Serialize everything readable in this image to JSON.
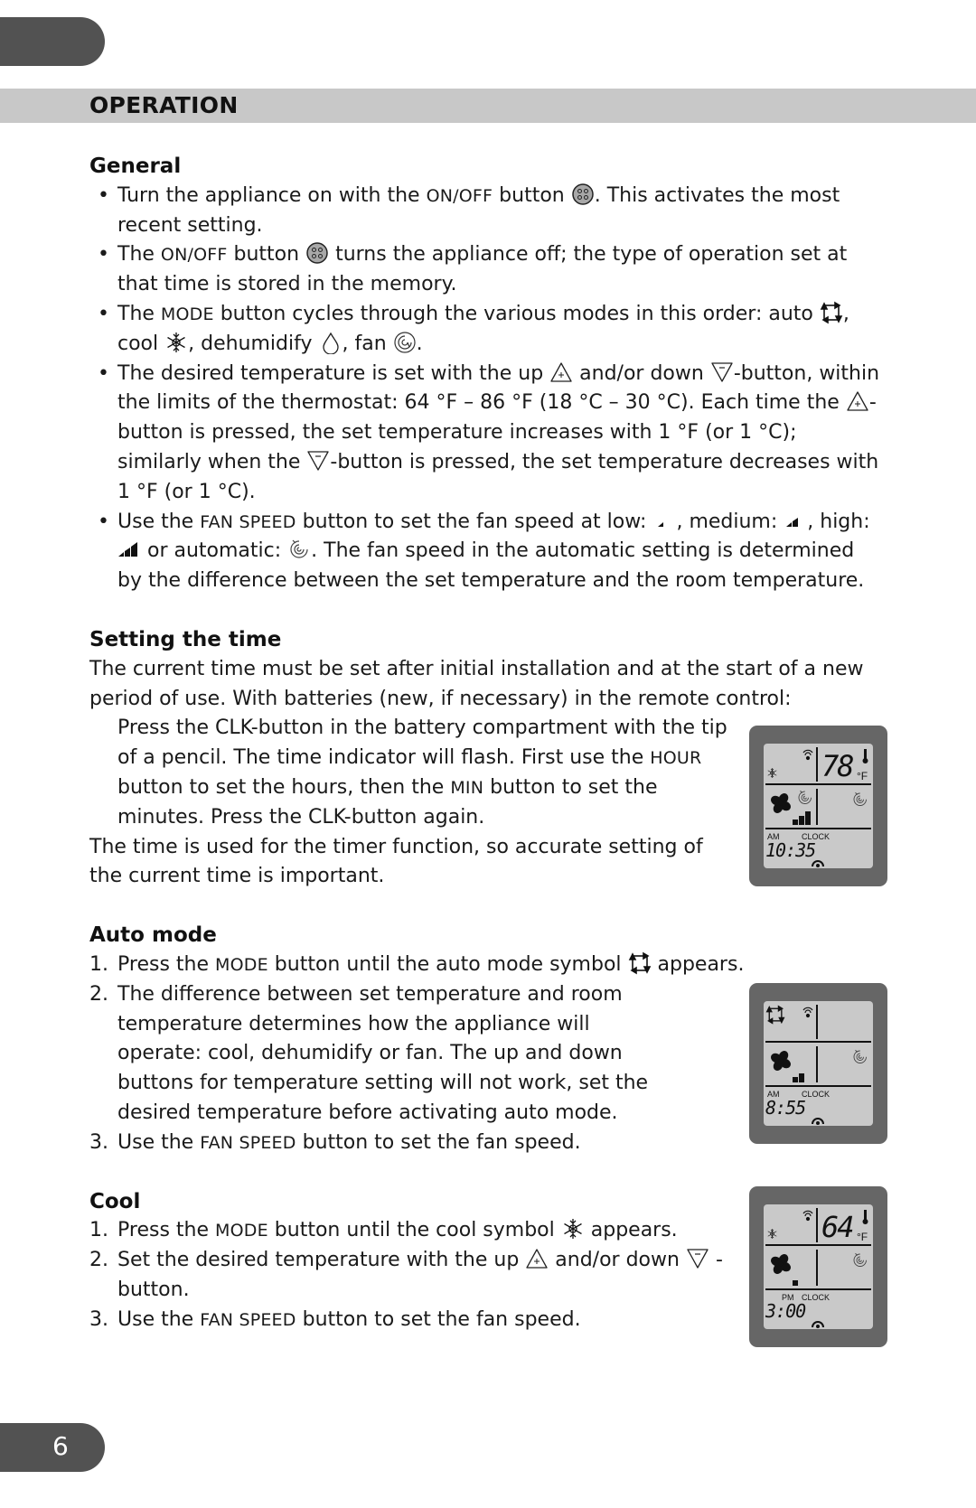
{
  "header": {
    "title": "OPERATION"
  },
  "sections": {
    "general": {
      "heading": "General",
      "items": [
        {
          "parts": [
            "Turn the appliance on with the ",
            "ON/OFF",
            " button ",
            "[on-off-icon]",
            ". This activates the most recent setting."
          ]
        },
        {
          "parts": [
            "The ",
            "ON/OFF",
            " button ",
            "[on-off-icon]",
            " turns the appliance off; the type of operation set at that time is stored in the memory."
          ]
        },
        {
          "parts": [
            "The ",
            "MODE",
            " button cycles through the various modes in this order: auto ",
            "[auto-icon]",
            ", cool ",
            "[cool-icon]",
            ", dehumidify ",
            "[dehumidify-icon]",
            ", fan ",
            "[fan-icon]",
            "."
          ]
        },
        {
          "parts": [
            "The desired temperature is set with the up ",
            "[up-icon]",
            " and/or down ",
            "[down-icon]",
            "-button, within the limits of the thermostat: 64 °F – 86 °F (18 °C – 30 °C). Each time the ",
            "[up-icon]",
            "-button is pressed, the set temperature increases with 1 °F (or 1 °C); similarly when the ",
            "[down-icon]",
            "-button is pressed, the set temperature decreases with 1 °F (or 1 °C)."
          ]
        },
        {
          "parts": [
            "Use the ",
            "FAN SPEED",
            " button to set the fan speed at low: ",
            "[low-icon]",
            ", medium: ",
            "[medium-icon]",
            ", high: ",
            "[high-icon]",
            " or automatic: ",
            "[auto-fan-icon]",
            ". The fan speed in the automatic setting is determined by the difference between the set temperature and the room temperature."
          ]
        }
      ],
      "t": {
        "i1a": "Turn the appliance on with the ",
        "i1b": "ON/OFF",
        "i1c": " button ",
        "i1d": ". This activates the most recent setting.",
        "i2a": "The ",
        "i2b": "ON/OFF",
        "i2c": " button ",
        "i2d": " turns the appliance off; the type of operation set at that time is stored in the memory.",
        "i3a": "The ",
        "i3b": "MODE",
        "i3c": " button cycles through the various modes in this order: auto ",
        "i3d": ", cool ",
        "i3e": ", dehumidify ",
        "i3f": ", fan ",
        "i3g": ".",
        "i4a": "The desired temperature is set with the up ",
        "i4b": " and/or down ",
        "i4c": "-button, within the limits of the thermostat: 64 °F – 86 °F (18 °C – 30 °C). Each time the ",
        "i4d": "-button is pressed, the set temperature increases with 1 °F (or 1 °C); similarly when the ",
        "i4e": "-button is pressed, the set temperature decreases with 1 °F (or 1 °C).",
        "i5a": "Use the ",
        "i5b": "FAN SPEED",
        "i5c": " button to set the fan speed at low: ",
        "i5d": ", medium: ",
        "i5e": ", high: ",
        "i5f": " or automatic: ",
        "i5g": ". The fan speed in the automatic setting is determined by the difference between the set temperature and the room temperature."
      }
    },
    "setting_time": {
      "heading": "Setting the time",
      "intro": "The current time must be set after initial installation and at the start of a new period of use. With batteries (new, if necessary) in the remote control:",
      "step_a": "Press the CLK-button in the battery compartment with the tip of a pencil. The time indicator will flash. First use the ",
      "step_hour": "HOUR",
      "step_b": " button to set the hours, then the ",
      "step_min": "MIN",
      "step_c": " button to set the minutes. Press the CLK-button again.",
      "outro": "The time is used for the timer function, so accurate setting of the current time is important."
    },
    "auto_mode": {
      "heading": "Auto mode",
      "n1": "1.",
      "s1a": "Press the ",
      "s1b": "MODE",
      "s1c": " button until the auto mode symbol ",
      "s1d": " appears.",
      "n2": "2.",
      "s2": "The difference between set temperature and room temperature determines how the appliance will operate: cool, dehumidify or fan. The up and down buttons for temperature setting will not work, set the desired temperature before activating auto mode.",
      "n3": "3.",
      "s3a": "Use the ",
      "s3b": "FAN SPEED",
      "s3c": " button to set the fan speed."
    },
    "cool": {
      "heading": "Cool",
      "n1": "1.",
      "s1a": "Press the ",
      "s1b": "MODE",
      "s1c": " button until the cool symbol ",
      "s1d": " appears.",
      "n2": "2.",
      "s2a": "Set the desired temperature with the up ",
      "s2b": " and/or down ",
      "s2c": " -button.",
      "n3": "3.",
      "s3a": "Use the ",
      "s3b": "FAN SPEED",
      "s3c": " button to set the fan speed."
    }
  },
  "displays": [
    {
      "temp": "78",
      "unit": "°F",
      "ampm": "AM",
      "clock_label": "CLOCK",
      "time": "10:35",
      "mode": "cool",
      "fan_speed": "high"
    },
    {
      "temp": "",
      "unit": "",
      "ampm": "AM",
      "clock_label": "CLOCK",
      "time": "8:55",
      "mode": "auto",
      "fan_speed": "medium"
    },
    {
      "temp": "64",
      "unit": "°F",
      "ampm": "PM",
      "clock_label": "CLOCK",
      "time": "3:00",
      "mode": "cool",
      "fan_speed": "low"
    }
  ],
  "footer": {
    "page_number": "6"
  },
  "colors": {
    "pill": "#525252",
    "band": "#c8c8c8",
    "lcd_frame": "#666666",
    "lcd_screen": "#c9c9c9"
  }
}
